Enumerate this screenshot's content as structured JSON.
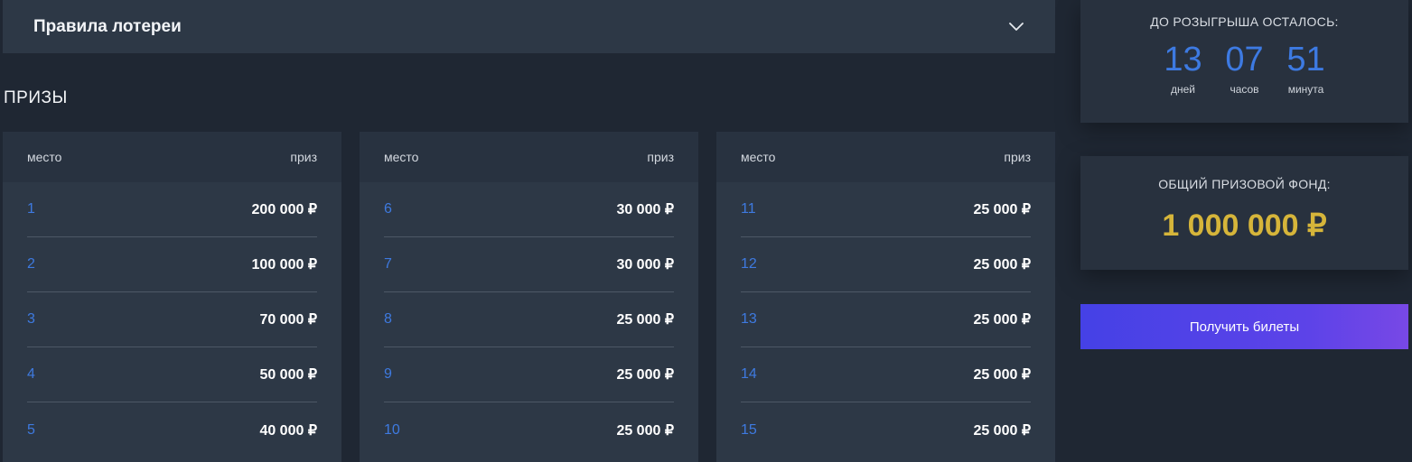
{
  "rules": {
    "title": "Правила лотереи",
    "icon": "chevron-down-icon"
  },
  "prizes": {
    "heading": "ПРИЗЫ",
    "columns": [
      {
        "place_header": "место",
        "prize_header": "приз",
        "rows": [
          {
            "place": "1",
            "prize": "200 000 ₽"
          },
          {
            "place": "2",
            "prize": "100 000 ₽"
          },
          {
            "place": "3",
            "prize": "70 000 ₽"
          },
          {
            "place": "4",
            "prize": "50 000 ₽"
          },
          {
            "place": "5",
            "prize": "40 000 ₽"
          }
        ]
      },
      {
        "place_header": "место",
        "prize_header": "приз",
        "rows": [
          {
            "place": "6",
            "prize": "30 000 ₽"
          },
          {
            "place": "7",
            "prize": "30 000 ₽"
          },
          {
            "place": "8",
            "prize": "25 000 ₽"
          },
          {
            "place": "9",
            "prize": "25 000 ₽"
          },
          {
            "place": "10",
            "prize": "25 000 ₽"
          }
        ]
      },
      {
        "place_header": "место",
        "prize_header": "приз",
        "rows": [
          {
            "place": "11",
            "prize": "25 000 ₽"
          },
          {
            "place": "12",
            "prize": "25 000 ₽"
          },
          {
            "place": "13",
            "prize": "25 000 ₽"
          },
          {
            "place": "14",
            "prize": "25 000 ₽"
          },
          {
            "place": "15",
            "prize": "25 000 ₽"
          }
        ]
      }
    ]
  },
  "countdown": {
    "label": "ДО РОЗЫГРЫША ОСТАЛОСЬ:",
    "units": [
      {
        "value": "13",
        "label": "дней"
      },
      {
        "value": "07",
        "label": "часов"
      },
      {
        "value": "51",
        "label": "минута"
      }
    ]
  },
  "fund": {
    "label": "ОБЩИЙ ПРИЗОВОЙ ФОНД:",
    "value": "1 000 000 ₽"
  },
  "cta": {
    "label": "Получить билеты"
  },
  "colors": {
    "background": "#1f2733",
    "panel": "#2d3846",
    "accent_blue": "#3d7ae2",
    "gold": "#d6b53a",
    "button_gradient_start": "#4541e6",
    "button_gradient_end": "#7848e6"
  }
}
